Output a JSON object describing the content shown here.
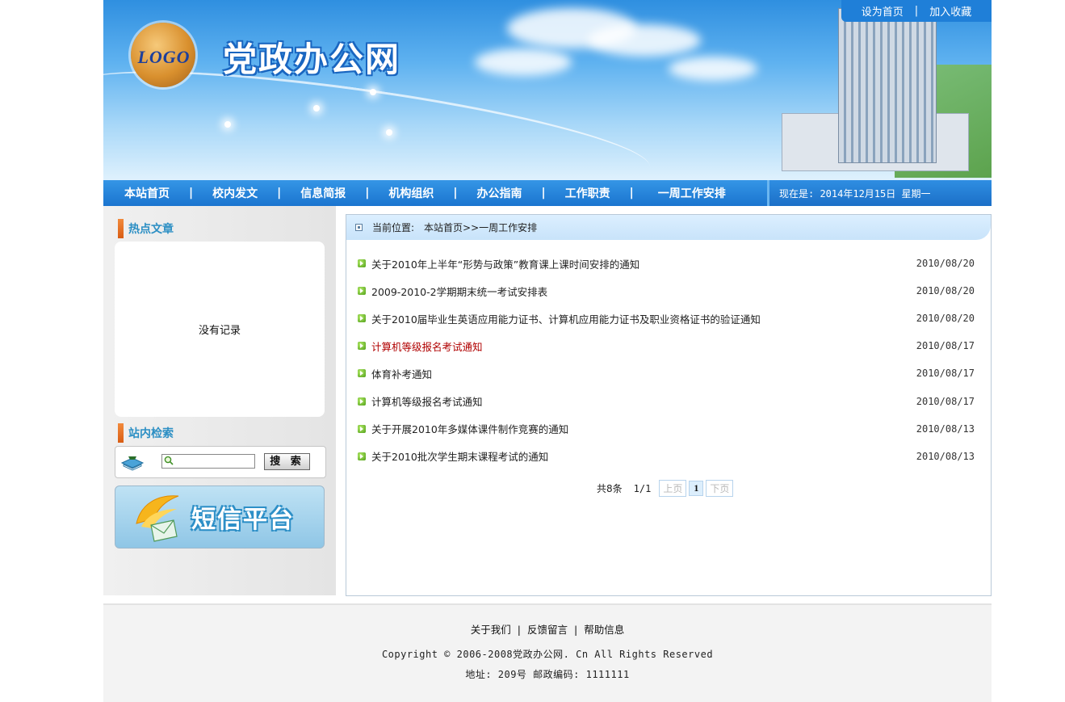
{
  "header": {
    "logo_text": "LOGO",
    "site_title": "党政办公网",
    "top_links": [
      "设为首页",
      "加入收藏"
    ],
    "top_links_sep": "|"
  },
  "nav": {
    "items": [
      "本站首页",
      "校内发文",
      "信息简报",
      "机构组织",
      "办公指南",
      "工作职责",
      "一周工作安排"
    ],
    "sep": "|",
    "date_text": "现在是: 2014年12月15日  星期一"
  },
  "sidebar": {
    "hot_title": "热点文章",
    "hot_empty": "没有记录",
    "search_title": "站内检索",
    "search_button": "搜 索",
    "sms_text": "短信平台"
  },
  "main": {
    "crumb_label": "当前位置:",
    "crumb_path": "本站首页>>一周工作安排",
    "articles": [
      {
        "title": "关于2010年上半年“形势与政策”教育课上课时间安排的通知",
        "date": "2010/08/20",
        "highlight": false
      },
      {
        "title": "2009-2010-2学期期末统一考试安排表",
        "date": "2010/08/20",
        "highlight": false
      },
      {
        "title": "关于2010届毕业生英语应用能力证书、计算机应用能力证书及职业资格证书的验证通知",
        "date": "2010/08/20",
        "highlight": false
      },
      {
        "title": "计算机等级报名考试通知",
        "date": "2010/08/17",
        "highlight": true
      },
      {
        "title": "体育补考通知",
        "date": "2010/08/17",
        "highlight": false
      },
      {
        "title": "计算机等级报名考试通知",
        "date": "2010/08/17",
        "highlight": false
      },
      {
        "title": "关于开展2010年多媒体课件制作竞赛的通知",
        "date": "2010/08/13",
        "highlight": false
      },
      {
        "title": "关于2010批次学生期末课程考试的通知",
        "date": "2010/08/13",
        "highlight": false
      }
    ],
    "pager": {
      "total": "共8条",
      "page": "1/1",
      "prev": "上页",
      "current": "1",
      "next": "下页"
    }
  },
  "footer": {
    "links": [
      "关于我们",
      "反馈留言",
      "帮助信息"
    ],
    "links_sep": "|",
    "copyright": "Copyright ©  2006-2008党政办公网. Cn All Rights Reserved",
    "address": "地址: 209号 邮政编码: 1111111"
  },
  "colors": {
    "nav_blue": "#1a74cf",
    "section_title": "#2c8fc4",
    "highlight_red": "#b00000",
    "bullet_green": "#4e9e17"
  }
}
